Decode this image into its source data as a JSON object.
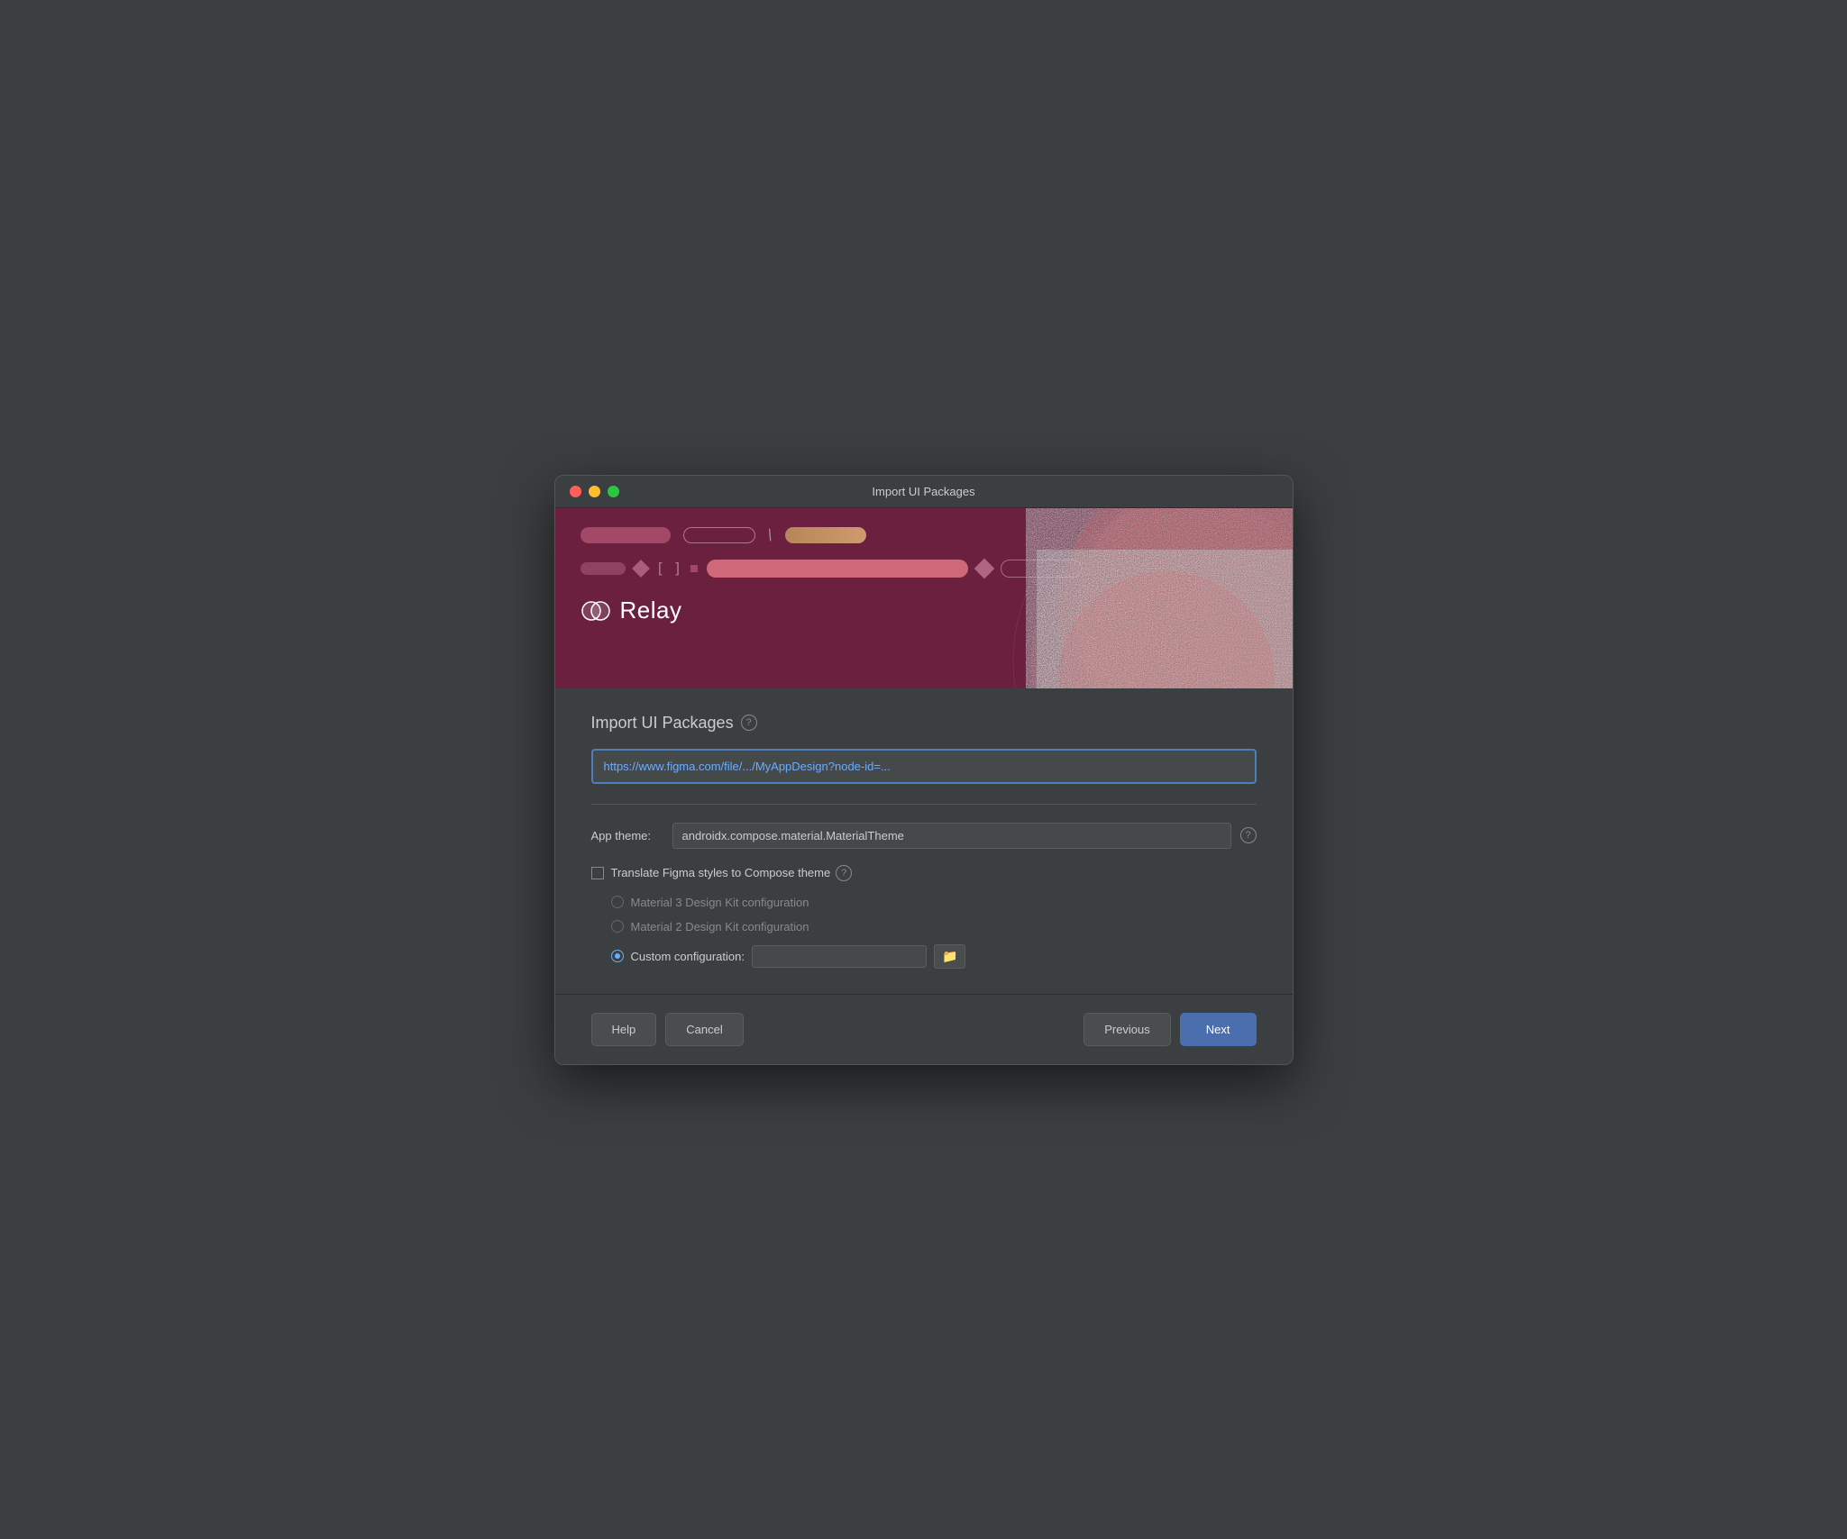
{
  "window": {
    "title": "Import UI Packages"
  },
  "hero": {
    "logo_text": "Relay"
  },
  "main": {
    "section_title": "Import UI Packages",
    "url_input": {
      "value": "https://www.figma.com/file/.../MyAppDesign?node-id=...",
      "placeholder": "https://www.figma.com/file/.../MyAppDesign?node-id=..."
    },
    "app_theme_label": "App theme:",
    "app_theme_value": "androidx.compose.material.MaterialTheme",
    "translate_checkbox_label": "Translate Figma styles to Compose theme",
    "radio_options": [
      {
        "id": "material3",
        "label": "Material 3 Design Kit configuration",
        "checked": false
      },
      {
        "id": "material2",
        "label": "Material 2 Design Kit configuration",
        "checked": false
      },
      {
        "id": "custom",
        "label": "Custom configuration:",
        "checked": true
      }
    ]
  },
  "footer": {
    "help_label": "Help",
    "cancel_label": "Cancel",
    "previous_label": "Previous",
    "next_label": "Next"
  }
}
